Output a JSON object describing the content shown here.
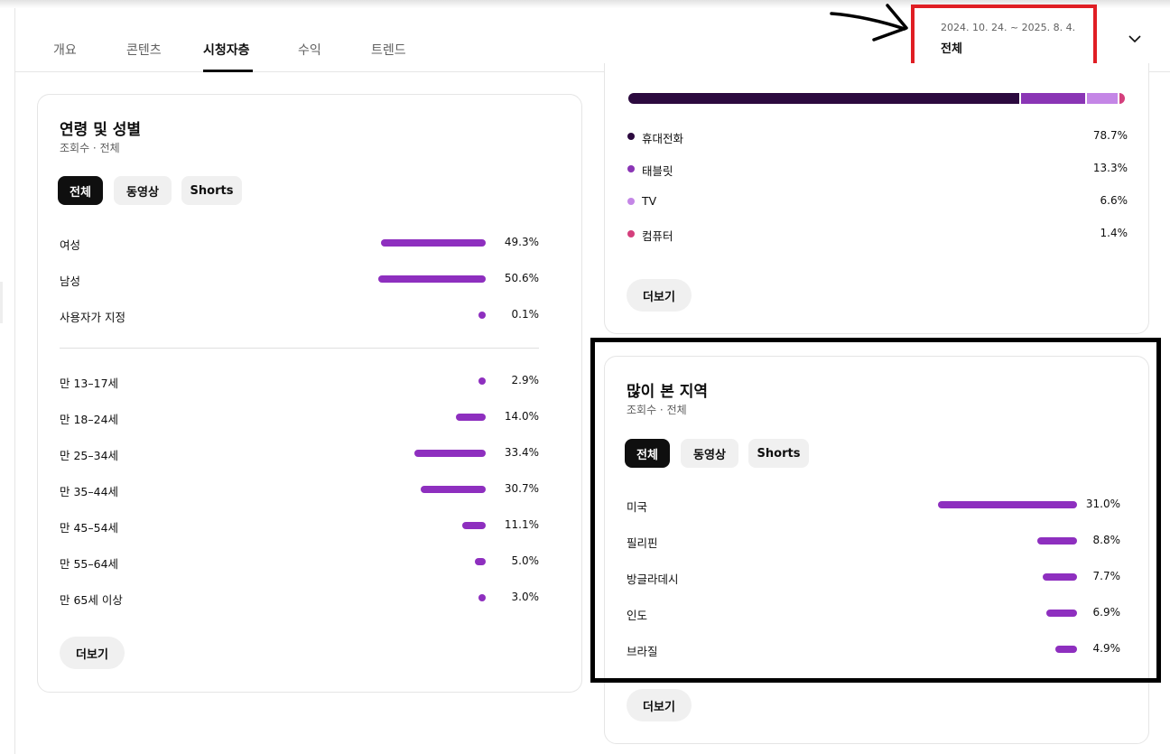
{
  "header": {
    "tabs": [
      {
        "label": "개요",
        "active": false
      },
      {
        "label": "콘텐츠",
        "active": false
      },
      {
        "label": "시청자층",
        "active": true
      },
      {
        "label": "수익",
        "active": false
      },
      {
        "label": "트렌드",
        "active": false
      }
    ],
    "date_range": "2024. 10. 24. ~ 2025. 8. 4.",
    "date_value": "전체",
    "dropdown_icon": "chevron-down-icon"
  },
  "annotations": {
    "date_box_color": "#e01e24",
    "region_box_color": "#000000",
    "arrow_icon": "arrow-right-icon"
  },
  "age_gender": {
    "title": "연령 및 성별",
    "subtitle": "조회수 · 전체",
    "chips": [
      "전체",
      "동영상",
      "Shorts"
    ],
    "selected_chip": "전체",
    "gender": [
      {
        "label": "여성",
        "value": "49.3%",
        "pct": 49.3
      },
      {
        "label": "남성",
        "value": "50.6%",
        "pct": 50.6
      },
      {
        "label": "사용자가 지정",
        "value": "0.1%",
        "pct": 0.1
      }
    ],
    "age": [
      {
        "label": "만 13–17세",
        "value": "2.9%",
        "pct": 2.9
      },
      {
        "label": "만 18–24세",
        "value": "14.0%",
        "pct": 14.0
      },
      {
        "label": "만 25–34세",
        "value": "33.4%",
        "pct": 33.4
      },
      {
        "label": "만 35–44세",
        "value": "30.7%",
        "pct": 30.7
      },
      {
        "label": "만 45–54세",
        "value": "11.1%",
        "pct": 11.1
      },
      {
        "label": "만 55–64세",
        "value": "5.0%",
        "pct": 5.0
      },
      {
        "label": "만 65세 이상",
        "value": "3.0%",
        "pct": 3.0
      }
    ],
    "more_label": "더보기",
    "bar_color": "#8e2fbf"
  },
  "devices": {
    "items": [
      {
        "label": "휴대전화",
        "value": "78.7%",
        "pct": 78.7,
        "color": "#2c0a3f"
      },
      {
        "label": "태블릿",
        "value": "13.3%",
        "pct": 13.3,
        "color": "#8a35b5"
      },
      {
        "label": "TV",
        "value": "6.6%",
        "pct": 6.6,
        "color": "#c486e6"
      },
      {
        "label": "컴퓨터",
        "value": "1.4%",
        "pct": 1.4,
        "color": "#d43f7c"
      }
    ],
    "more_label": "더보기"
  },
  "regions": {
    "title": "많이 본 지역",
    "subtitle": "조회수 · 전체",
    "chips": [
      "전체",
      "동영상",
      "Shorts"
    ],
    "selected_chip": "전체",
    "items": [
      {
        "label": "미국",
        "value": "31.0%",
        "pct": 31.0
      },
      {
        "label": "필리핀",
        "value": "8.8%",
        "pct": 8.8
      },
      {
        "label": "방글라데시",
        "value": "7.7%",
        "pct": 7.7
      },
      {
        "label": "인도",
        "value": "6.9%",
        "pct": 6.9
      },
      {
        "label": "브라질",
        "value": "4.9%",
        "pct": 4.9
      }
    ],
    "more_label": "더보기",
    "bar_color": "#8e2fbf"
  }
}
